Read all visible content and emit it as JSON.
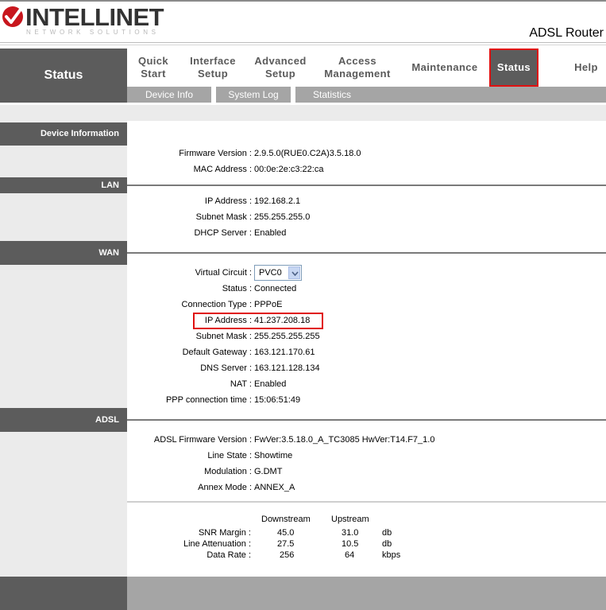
{
  "header": {
    "brand": "INTELLINET",
    "brand_sub": "NETWORK SOLUTIONS",
    "model": "ADSL Router"
  },
  "nav": {
    "page_label": "Status",
    "items": [
      {
        "label": "Quick Start"
      },
      {
        "label": "Interface Setup"
      },
      {
        "label": "Advanced Setup"
      },
      {
        "label": "Access Management"
      },
      {
        "label": "Maintenance"
      },
      {
        "label": "Status",
        "active": true
      },
      {
        "label": "Help"
      }
    ],
    "subitems": [
      {
        "label": "Device Info"
      },
      {
        "label": "System Log"
      },
      {
        "label": "Statistics"
      }
    ]
  },
  "sections": {
    "device_information": {
      "title": "Device Information",
      "firmware_label": "Firmware Version :",
      "firmware_value": "2.9.5.0(RUE0.C2A)3.5.18.0",
      "mac_label": "MAC Address :",
      "mac_value": "00:0e:2e:c3:22:ca"
    },
    "lan": {
      "title": "LAN",
      "ip_label": "IP Address :",
      "ip_value": "192.168.2.1",
      "mask_label": "Subnet Mask :",
      "mask_value": "255.255.255.0",
      "dhcp_label": "DHCP Server :",
      "dhcp_value": "Enabled"
    },
    "wan": {
      "title": "WAN",
      "vc_label": "Virtual Circuit :",
      "vc_value": "PVC0",
      "status_label": "Status :",
      "status_value": "Connected",
      "conn_label": "Connection Type :",
      "conn_value": "PPPoE",
      "ip_label": "IP Address :",
      "ip_value": "41.237.208.18",
      "mask_label": "Subnet Mask :",
      "mask_value": "255.255.255.255",
      "gw_label": "Default Gateway :",
      "gw_value": "163.121.170.61",
      "dns_label": "DNS Server :",
      "dns_value": "163.121.128.134",
      "nat_label": "NAT :",
      "nat_value": "Enabled",
      "ppp_label": "PPP connection time :",
      "ppp_value": "15:06:51:49"
    },
    "adsl": {
      "title": "ADSL",
      "fw_label": "ADSL Firmware Version :",
      "fw_value": "FwVer:3.5.18.0_A_TC3085 HwVer:T14.F7_1.0",
      "line_label": "Line State :",
      "line_value": "Showtime",
      "mod_label": "Modulation :",
      "mod_value": "G.DMT",
      "annex_label": "Annex Mode :",
      "annex_value": "ANNEX_A",
      "stats": {
        "col_downstream": "Downstream",
        "col_upstream": "Upstream",
        "rows": [
          {
            "label": "SNR Margin :",
            "down": "45.0",
            "up": "31.0",
            "unit": "db"
          },
          {
            "label": "Line Attenuation :",
            "down": "27.5",
            "up": "10.5",
            "unit": "db"
          },
          {
            "label": "Data Rate :",
            "down": "256",
            "up": "64",
            "unit": "kbps"
          }
        ]
      }
    }
  },
  "colors": {
    "dark_gray": "#5c5c5c",
    "mid_gray": "#a5a5a5",
    "light_gray": "#ebebeb",
    "highlight_red": "#e01010"
  }
}
